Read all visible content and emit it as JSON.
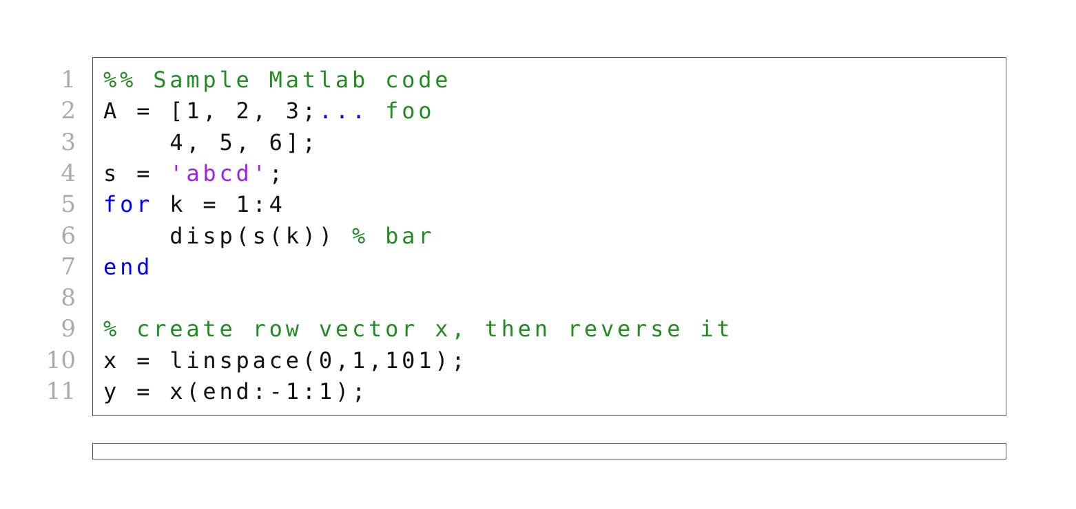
{
  "lines": [
    {
      "n": "1",
      "tokens": [
        {
          "t": "%% Sample Matlab code",
          "k": "comment"
        }
      ]
    },
    {
      "n": "2",
      "tokens": [
        {
          "t": "A = [1, 2, 3;",
          "k": "plain"
        },
        {
          "t": "...",
          "k": "keyword"
        },
        {
          "t": " foo",
          "k": "comment"
        }
      ]
    },
    {
      "n": "3",
      "tokens": [
        {
          "t": "    4, 5, 6];",
          "k": "plain"
        }
      ]
    },
    {
      "n": "4",
      "tokens": [
        {
          "t": "s = ",
          "k": "plain"
        },
        {
          "t": "'abcd'",
          "k": "string"
        },
        {
          "t": ";",
          "k": "plain"
        }
      ]
    },
    {
      "n": "5",
      "tokens": [
        {
          "t": "for",
          "k": "keyword"
        },
        {
          "t": " k = 1:4",
          "k": "plain"
        }
      ]
    },
    {
      "n": "6",
      "tokens": [
        {
          "t": "    disp(s(k)) ",
          "k": "plain"
        },
        {
          "t": "% bar",
          "k": "comment"
        }
      ]
    },
    {
      "n": "7",
      "tokens": [
        {
          "t": "end",
          "k": "keyword"
        }
      ]
    },
    {
      "n": "8",
      "tokens": []
    },
    {
      "n": "9",
      "tokens": [
        {
          "t": "% create row vector x, then reverse it",
          "k": "comment"
        }
      ]
    },
    {
      "n": "10",
      "tokens": [
        {
          "t": "x = linspace(0,1,101);",
          "k": "plain"
        }
      ]
    },
    {
      "n": "11",
      "tokens": [
        {
          "t": "y = x(end:-1:1);",
          "k": "plain"
        }
      ]
    }
  ],
  "colors": {
    "comment": "#228B22",
    "keyword": "#0000ff",
    "string": "#a020f0",
    "plain": "#111111",
    "line_number": "#aaaaaa",
    "frame": "#555555"
  }
}
